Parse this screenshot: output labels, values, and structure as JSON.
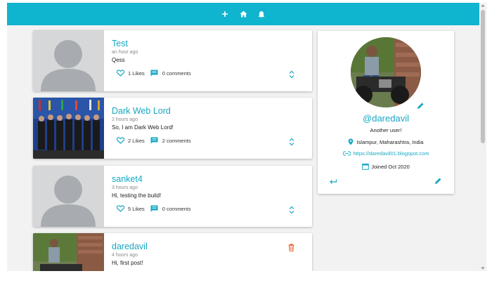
{
  "topbar": {
    "icons": [
      "plus-icon",
      "home-icon",
      "bell-icon"
    ],
    "color": "#0fb4cf"
  },
  "posts": [
    {
      "username": "Test",
      "time": "an hour ago",
      "text": "Qess",
      "likes": "1 Likes",
      "comments": "0 comments",
      "thumb": "default-avatar"
    },
    {
      "username": "Dark Web Lord",
      "time": "2 hours ago",
      "text": "So, I am Dark Web Lord!",
      "likes": "2 Likes",
      "comments": "2 comments",
      "thumb": "group-photo"
    },
    {
      "username": "sanket4",
      "time": "3 hours ago",
      "text": "Hi, testing the build!",
      "likes": "5 Likes",
      "comments": "0 comments",
      "thumb": "default-avatar"
    },
    {
      "username": "daredavil",
      "time": "4 hours ago",
      "text": "Hi, first post!",
      "thumb": "motorbike-photo"
    }
  ],
  "profile": {
    "handle": "@daredavil",
    "bio": "Another user!",
    "location": "Islampur, Maharashtra, India",
    "website": "https://daredavil01.blogspot.com",
    "joined": "Joined Oct 2020"
  },
  "colors": {
    "accent": "#17a8c3",
    "danger": "#e8663a",
    "avatar_gray": "#d6d7d9"
  }
}
